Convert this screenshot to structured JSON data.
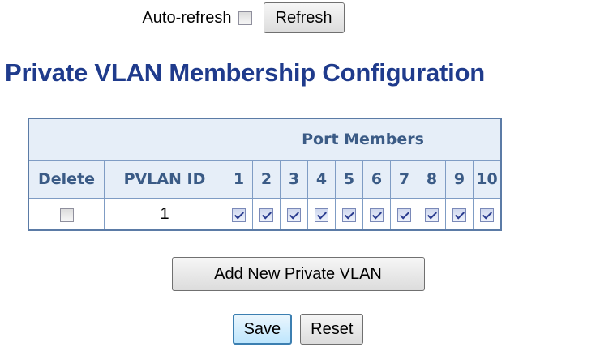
{
  "refresh": {
    "label": "Auto-refresh",
    "checked": false,
    "button_label": "Refresh"
  },
  "page_title": "Private VLAN Membership Configuration",
  "table": {
    "group_header": "Port Members",
    "columns": {
      "delete": "Delete",
      "pvlan_id": "PVLAN ID"
    },
    "ports": [
      "1",
      "2",
      "3",
      "4",
      "5",
      "6",
      "7",
      "8",
      "9",
      "10"
    ],
    "rows": [
      {
        "delete": false,
        "pvlan_id": "1",
        "members": [
          true,
          true,
          true,
          true,
          true,
          true,
          true,
          true,
          true,
          true
        ]
      }
    ]
  },
  "buttons": {
    "add_new": "Add New Private VLAN",
    "save": "Save",
    "reset": "Reset"
  },
  "colors": {
    "title": "#1f3b8c",
    "header_bg": "#e6eef8",
    "header_text": "#3b5b86",
    "table_border": "#5b7ba6"
  },
  "icons": {
    "checkbox_checked": "checkmark",
    "checkbox_unchecked": "empty-box"
  }
}
